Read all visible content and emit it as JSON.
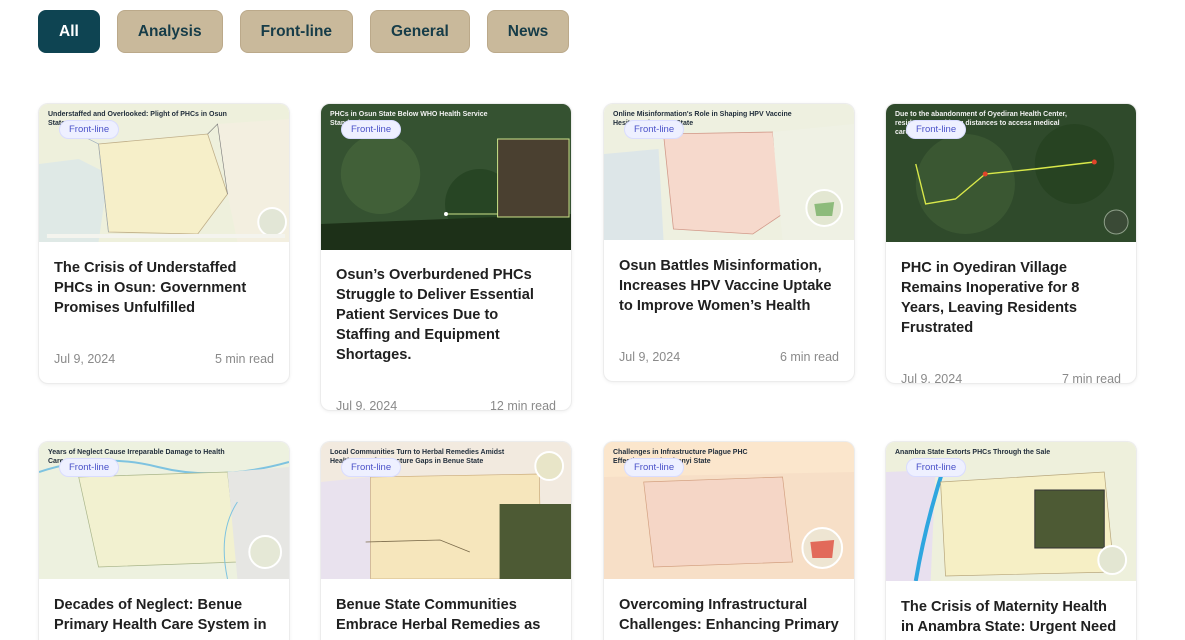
{
  "filters": [
    {
      "label": "All",
      "active": true
    },
    {
      "label": "Analysis",
      "active": false
    },
    {
      "label": "Front-line",
      "active": false
    },
    {
      "label": "General",
      "active": false
    },
    {
      "label": "News",
      "active": false
    }
  ],
  "cards": [
    {
      "tag": "Front-line",
      "thumb_title": "Understaffed and Overlooked: Plight of PHCs in Osun State",
      "title": "The Crisis of Understaffed PHCs in Osun: Government Promises Unfulfilled",
      "date": "Jul 9, 2024",
      "read_time": "5 min read"
    },
    {
      "tag": "Front-line",
      "thumb_title": "PHCs in Osun State Below WHO Health Service Standards",
      "title": "Osun’s Overburdened PHCs Struggle to Deliver Essential Patient Services Due to Staffing and Equipment Shortages.",
      "date": "Jul 9, 2024",
      "read_time": "12 min read"
    },
    {
      "tag": "Front-line",
      "thumb_title": "Online Misinformation's Role in Shaping HPV Vaccine Hesitancy in Osun State",
      "title": "Osun Battles Misinformation, Increases HPV Vaccine Uptake to Improve Women’s Health",
      "date": "Jul 9, 2024",
      "read_time": "6 min read"
    },
    {
      "tag": "Front-line",
      "thumb_title": "Due to the abandonment of Oyediran Health Center, residents travel long distances to access medical care",
      "title": "PHC in Oyediran Village Remains Inoperative for 8 Years, Leaving Residents Frustrated",
      "date": "Jul 9, 2024",
      "read_time": "7 min read"
    },
    {
      "tag": "Front-line",
      "thumb_title": "Years of Neglect Cause Irreparable Damage to Health Care",
      "title": "Decades of Neglect: Benue Primary Health Care System in",
      "date": "",
      "read_time": ""
    },
    {
      "tag": "Front-line",
      "thumb_title": "Local Communities Turn to Herbal Remedies Amidst Healthcare Infrastructure Gaps in Benue State",
      "title": "Benue State Communities Embrace Herbal Remedies as",
      "date": "",
      "read_time": ""
    },
    {
      "tag": "Front-line",
      "thumb_title": "Challenges in Infrastructure Plague PHC Effectiveness in Ebonyi State",
      "title": "Overcoming Infrastructural Challenges: Enhancing Primary",
      "date": "",
      "read_time": ""
    },
    {
      "tag": "Front-line",
      "thumb_title": "Anambra State Extorts PHCs Through the Sale",
      "title": "The Crisis of Maternity Health in Anambra State: Urgent Need for",
      "date": "",
      "read_time": ""
    }
  ],
  "colors": {
    "accent": "#0e4452",
    "filter_bg": "#c9b99b",
    "tag_bg": "#eef0ff",
    "tag_text": "#4b52c9"
  }
}
